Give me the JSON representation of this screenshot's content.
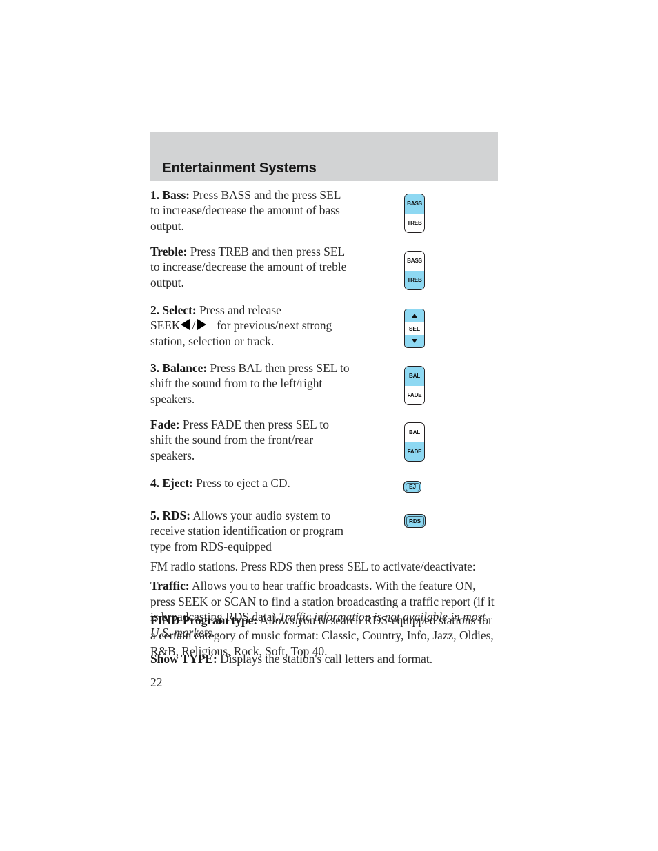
{
  "header": {
    "title": "Entertainment Systems",
    "banner_color": "#d2d3d4"
  },
  "colors": {
    "button_highlight": "#8ed8f2",
    "button_outline": "#231f20",
    "text": "#2b2b2b"
  },
  "sections": [
    {
      "number": "1.",
      "term": "Bass:",
      "text": " Press BASS and the press SEL to increase/decrease the amount of bass output."
    },
    {
      "number": "",
      "term": "Treble:",
      "text": " Press TREB and then press SEL to increase/decrease the amount of treble output."
    },
    {
      "number": "2.",
      "term": "Select:",
      "text": " Press and release",
      "seek_label": "SEEK",
      "seek_tail": "for previous/next strong station, selection or track."
    },
    {
      "number": "3.",
      "term": "Balance:",
      "text": " Press BAL then press SEL to shift the sound from to the left/right speakers."
    },
    {
      "number": "",
      "term": "Fade:",
      "text": " Press FADE then press SEL to shift the sound from the front/rear speakers."
    },
    {
      "number": "4.",
      "term": "Eject:",
      "text": " Press to eject a CD."
    },
    {
      "number": "5.",
      "term": "RDS:",
      "text": " Allows your audio system to receive station identification or program type from RDS-equipped"
    },
    {
      "number": "",
      "term": "",
      "text": "FM radio stations. Press RDS then press SEL to activate/deactivate:"
    },
    {
      "number": "",
      "term": "Traffic:",
      "text": " Allows you to hear traffic broadcasts. With the feature ON, press SEEK or SCAN to find a station broadcasting a traffic report (if it is broadcasting RDS data).",
      "italic_text": "Traffic information is not available in most U.S. markets."
    },
    {
      "number": "",
      "term": "FIND Program type:",
      "text": " Allows you to search RDS-equipped stations for a certain category of music format: Classic, Country, Info, Jazz, Oldies, R&B, Religious, Rock, Soft, Top 40."
    },
    {
      "number": "",
      "term": "Show TYPE:",
      "text": " Displays the station's call letters and format."
    }
  ],
  "buttons": {
    "bass_treb_1": {
      "top_label": "BASS",
      "bottom_label": "TREB",
      "highlighted": "top"
    },
    "bass_treb_2": {
      "top_label": "BASS",
      "bottom_label": "TREB",
      "highlighted": "bottom"
    },
    "select": {
      "label": "SEL",
      "up_icon": "triangle-up-icon",
      "down_icon": "triangle-down-icon"
    },
    "bal_fade_1": {
      "top_label": "BAL",
      "bottom_label": "FADE",
      "highlighted": "top"
    },
    "bal_fade_2": {
      "top_label": "BAL",
      "bottom_label": "FADE",
      "highlighted": "bottom"
    },
    "eject": {
      "label": "EJ"
    },
    "rds": {
      "label": "RDS"
    }
  },
  "footer": {
    "page_number": "22"
  }
}
